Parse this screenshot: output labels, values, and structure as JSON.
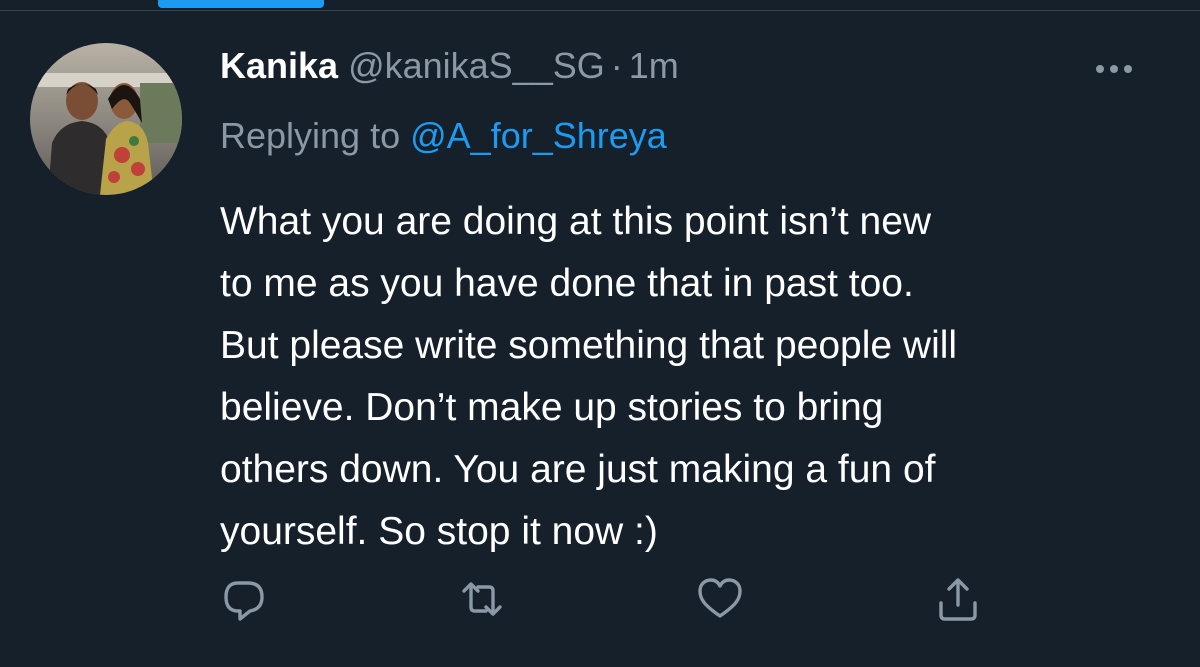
{
  "tweet": {
    "display_name": "Kanika",
    "handle": "@kanikaS__SG",
    "separator": "·",
    "timestamp": "1m",
    "replying_prefix": "Replying to",
    "replying_to": "@A_for_Shreya",
    "text_lines": [
      "What you are doing at this point isn’t new",
      "to me as you have done that in past too.",
      "But please write something that people will",
      "believe. Don’t make up stories to bring",
      "others down. You are just making a fun of",
      "yourself. So stop it now :)"
    ]
  },
  "icons": {
    "more": "more-horizontal-icon",
    "reply": "reply-icon",
    "retweet": "retweet-icon",
    "like": "heart-icon",
    "share": "share-icon"
  },
  "colors": {
    "background": "#15202b",
    "text_primary": "#ffffff",
    "text_secondary": "#8b98a5",
    "accent": "#1d9bf0"
  }
}
